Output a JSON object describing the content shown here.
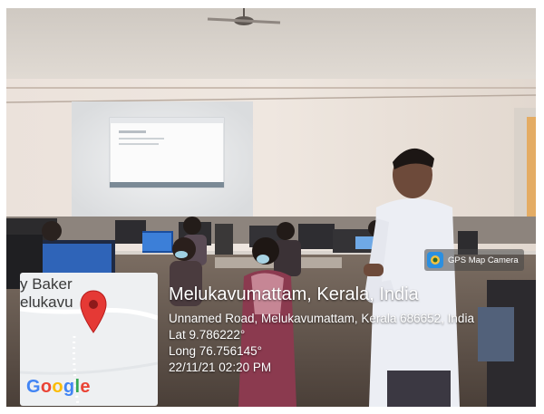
{
  "map": {
    "label_top": "y Baker",
    "label_bottom": "elukavu",
    "logo": "Google"
  },
  "location": {
    "title": "Melukavumattam, Kerala, India",
    "address": "Unnamed Road, Melukavumattam, Kerala 686652, India",
    "latitude": "Lat 9.786222°",
    "longitude": "Long 76.756145°",
    "datetime": "22/11/21 02:20 PM"
  },
  "app_badge": {
    "label": "GPS Map Camera",
    "icon": "camera-app-icon"
  },
  "colors": {
    "pin": "#E53935",
    "google_blue": "#4285F4",
    "google_red": "#EA4335",
    "google_yellow": "#FBBC05",
    "google_green": "#34A853"
  }
}
